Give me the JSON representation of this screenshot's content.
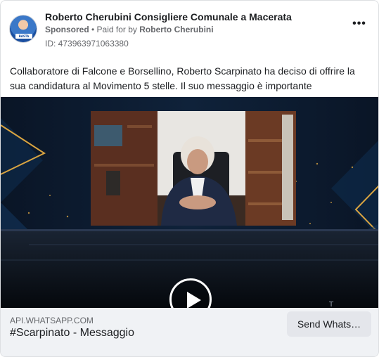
{
  "post": {
    "page_name": "Roberto Cherubini Consigliere Comunale a Macerata",
    "sponsored": "Sponsored",
    "paid_for_prefix": "• Paid for by",
    "payer": "Roberto Cherubini",
    "ad_id": "ID: 473963971063380",
    "more_icon": "more-horizontal-icon",
    "caption": "Collaboratore di Falcone e Borsellino, Roberto Scarpinato ha deciso di offrire la sua candidatura al Movimento 5 stelle. Il suo messaggio è importante",
    "avatar_text": "BASTA"
  },
  "video": {
    "play_icon": "play-icon"
  },
  "link": {
    "domain": "API.WHATSAPP.COM",
    "title": "#Scarpinato - Messaggio",
    "cta_label": "Send Whats…"
  },
  "colors": {
    "text_primary": "#1c1e21",
    "text_secondary": "#65676b",
    "footer_bg": "#f0f2f5",
    "button_bg": "#e4e6eb",
    "stage_accent": "#d9a441"
  }
}
